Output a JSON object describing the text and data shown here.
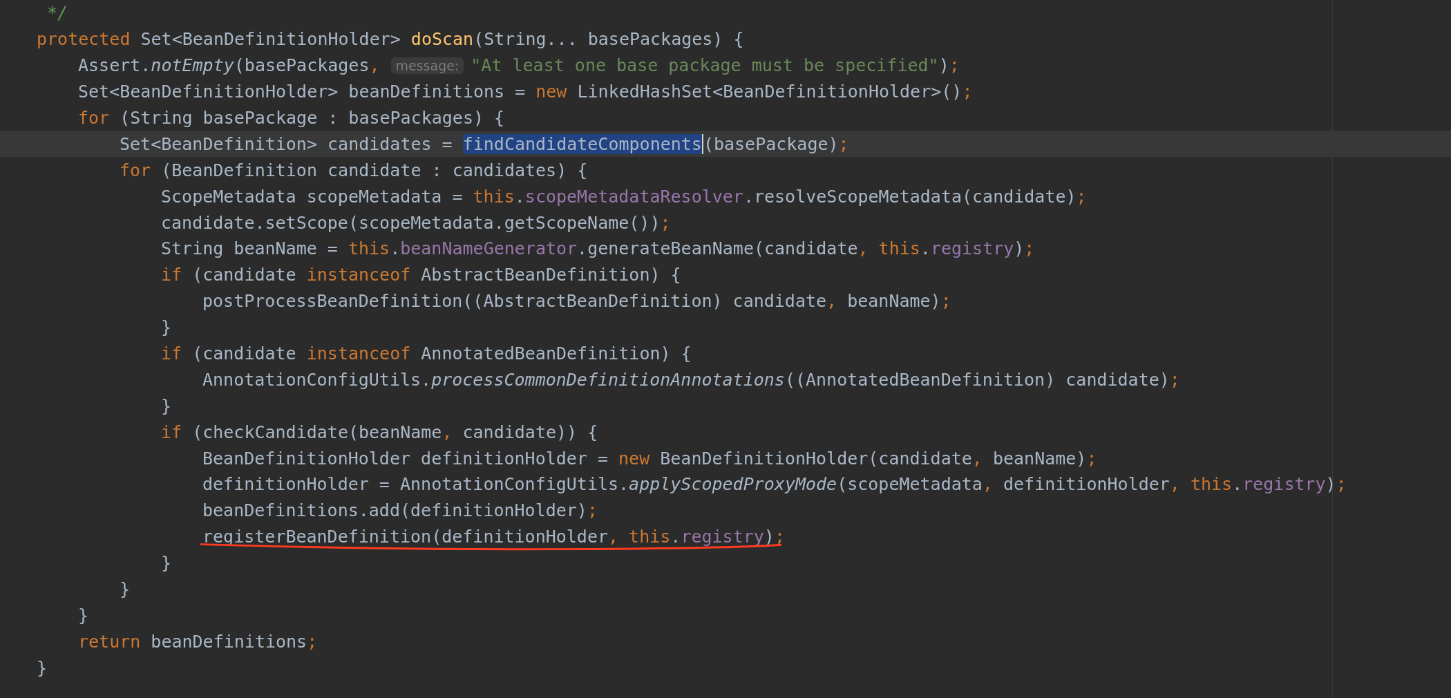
{
  "editor": {
    "lines": [
      {
        "current": false,
        "underlined": false,
        "tokens": [
          {
            "text": "*/",
            "kind": "comment"
          }
        ]
      },
      {
        "current": false,
        "underlined": false,
        "tokens": [
          {
            "text": "protected",
            "kind": "keyword"
          },
          {
            "text": " Set<BeanDefinitionHolder> ",
            "kind": "plain"
          },
          {
            "text": "doScan",
            "kind": "declaration"
          },
          {
            "text": "(String... basePackages) {",
            "kind": "plain"
          }
        ],
        "children": [
          {
            "current": false,
            "underlined": false,
            "tokens": [
              {
                "text": "Assert.",
                "kind": "plain"
              },
              {
                "text": "notEmpty",
                "kind": "static"
              },
              {
                "text": "(basePackages",
                "kind": "plain"
              },
              {
                "text": ",",
                "kind": "punct"
              },
              {
                "text": "message:",
                "kind": "hint"
              },
              {
                "text": "\"At least one base package must be specified\"",
                "kind": "string"
              },
              {
                "text": ")",
                "kind": "plain"
              },
              {
                "text": ";",
                "kind": "punct"
              }
            ]
          },
          {
            "current": false,
            "underlined": false,
            "tokens": [
              {
                "text": "Set<BeanDefinitionHolder> beanDefinitions = ",
                "kind": "plain"
              },
              {
                "text": "new",
                "kind": "keyword"
              },
              {
                "text": " LinkedHashSet<BeanDefinitionHolder>()",
                "kind": "plain"
              },
              {
                "text": ";",
                "kind": "punct"
              }
            ]
          },
          {
            "current": false,
            "underlined": false,
            "tokens": [
              {
                "text": "for",
                "kind": "keyword"
              },
              {
                "text": " (String basePackage : basePackages) {",
                "kind": "plain"
              }
            ],
            "children": [
              {
                "current": true,
                "underlined": false,
                "tokens": [
                  {
                    "text": "Set<BeanDefinition> candidates = ",
                    "kind": "plain"
                  },
                  {
                    "text": "findCandidateComponents",
                    "kind": "selection"
                  },
                  {
                    "text": "(basePackage)",
                    "kind": "plain"
                  },
                  {
                    "text": ";",
                    "kind": "punct"
                  }
                ]
              },
              {
                "current": false,
                "underlined": false,
                "tokens": [
                  {
                    "text": "for",
                    "kind": "keyword"
                  },
                  {
                    "text": " (BeanDefinition candidate : candidates) {",
                    "kind": "plain"
                  }
                ],
                "children": [
                  {
                    "current": false,
                    "underlined": false,
                    "tokens": [
                      {
                        "text": "ScopeMetadata scopeMetadata = ",
                        "kind": "plain"
                      },
                      {
                        "text": "this",
                        "kind": "keyword"
                      },
                      {
                        "text": ".",
                        "kind": "plain"
                      },
                      {
                        "text": "scopeMetadataResolver",
                        "kind": "field"
                      },
                      {
                        "text": ".resolveScopeMetadata(candidate)",
                        "kind": "plain"
                      },
                      {
                        "text": ";",
                        "kind": "punct"
                      }
                    ]
                  },
                  {
                    "current": false,
                    "underlined": false,
                    "tokens": [
                      {
                        "text": "candidate.setScope(scopeMetadata.getScopeName())",
                        "kind": "plain"
                      },
                      {
                        "text": ";",
                        "kind": "punct"
                      }
                    ]
                  },
                  {
                    "current": false,
                    "underlined": false,
                    "tokens": [
                      {
                        "text": "String beanName = ",
                        "kind": "plain"
                      },
                      {
                        "text": "this",
                        "kind": "keyword"
                      },
                      {
                        "text": ".",
                        "kind": "plain"
                      },
                      {
                        "text": "beanNameGenerator",
                        "kind": "field"
                      },
                      {
                        "text": ".generateBeanName(candidate",
                        "kind": "plain"
                      },
                      {
                        "text": ", ",
                        "kind": "punct"
                      },
                      {
                        "text": "this",
                        "kind": "keyword"
                      },
                      {
                        "text": ".",
                        "kind": "plain"
                      },
                      {
                        "text": "registry",
                        "kind": "field"
                      },
                      {
                        "text": ")",
                        "kind": "plain"
                      },
                      {
                        "text": ";",
                        "kind": "punct"
                      }
                    ]
                  },
                  {
                    "current": false,
                    "underlined": false,
                    "tokens": [
                      {
                        "text": "if",
                        "kind": "keyword"
                      },
                      {
                        "text": " (candidate ",
                        "kind": "plain"
                      },
                      {
                        "text": "instanceof",
                        "kind": "keyword"
                      },
                      {
                        "text": " AbstractBeanDefinition) {",
                        "kind": "plain"
                      }
                    ],
                    "children": [
                      {
                        "current": false,
                        "underlined": false,
                        "tokens": [
                          {
                            "text": "postProcessBeanDefinition((AbstractBeanDefinition) candidate",
                            "kind": "plain"
                          },
                          {
                            "text": ",",
                            "kind": "punct"
                          },
                          {
                            "text": " beanName)",
                            "kind": "plain"
                          },
                          {
                            "text": ";",
                            "kind": "punct"
                          }
                        ]
                      }
                    ]
                  },
                  {
                    "current": false,
                    "underlined": false,
                    "tokens": [
                      {
                        "text": "}",
                        "kind": "plain"
                      }
                    ]
                  },
                  {
                    "current": false,
                    "underlined": false,
                    "tokens": [
                      {
                        "text": "if",
                        "kind": "keyword"
                      },
                      {
                        "text": " (candidate ",
                        "kind": "plain"
                      },
                      {
                        "text": "instanceof",
                        "kind": "keyword"
                      },
                      {
                        "text": " AnnotatedBeanDefinition) {",
                        "kind": "plain"
                      }
                    ],
                    "children": [
                      {
                        "current": false,
                        "underlined": false,
                        "tokens": [
                          {
                            "text": "AnnotationConfigUtils.",
                            "kind": "plain"
                          },
                          {
                            "text": "processCommonDefinitionAnnotations",
                            "kind": "static"
                          },
                          {
                            "text": "((AnnotatedBeanDefinition) candidate)",
                            "kind": "plain"
                          },
                          {
                            "text": ";",
                            "kind": "punct"
                          }
                        ]
                      }
                    ]
                  },
                  {
                    "current": false,
                    "underlined": false,
                    "tokens": [
                      {
                        "text": "}",
                        "kind": "plain"
                      }
                    ]
                  },
                  {
                    "current": false,
                    "underlined": false,
                    "tokens": [
                      {
                        "text": "if",
                        "kind": "keyword"
                      },
                      {
                        "text": " (checkCandidate(beanName",
                        "kind": "plain"
                      },
                      {
                        "text": ",",
                        "kind": "punct"
                      },
                      {
                        "text": " candidate)) {",
                        "kind": "plain"
                      }
                    ],
                    "children": [
                      {
                        "current": false,
                        "underlined": false,
                        "tokens": [
                          {
                            "text": "BeanDefinitionHolder definitionHolder = ",
                            "kind": "plain"
                          },
                          {
                            "text": "new",
                            "kind": "keyword"
                          },
                          {
                            "text": " BeanDefinitionHolder(candidate",
                            "kind": "plain"
                          },
                          {
                            "text": ",",
                            "kind": "punct"
                          },
                          {
                            "text": " beanName)",
                            "kind": "plain"
                          },
                          {
                            "text": ";",
                            "kind": "punct"
                          }
                        ]
                      },
                      {
                        "current": false,
                        "underlined": false,
                        "tokens": [
                          {
                            "text": "definitionHolder = AnnotationConfigUtils.",
                            "kind": "plain"
                          },
                          {
                            "text": "applyScopedProxyMode",
                            "kind": "static"
                          },
                          {
                            "text": "(scopeMetadata",
                            "kind": "plain"
                          },
                          {
                            "text": ",",
                            "kind": "punct"
                          },
                          {
                            "text": " definitionHolder",
                            "kind": "plain"
                          },
                          {
                            "text": ", ",
                            "kind": "punct"
                          },
                          {
                            "text": "this",
                            "kind": "keyword"
                          },
                          {
                            "text": ".",
                            "kind": "plain"
                          },
                          {
                            "text": "registry",
                            "kind": "field"
                          },
                          {
                            "text": ")",
                            "kind": "plain"
                          },
                          {
                            "text": ";",
                            "kind": "punct"
                          }
                        ]
                      },
                      {
                        "current": false,
                        "underlined": false,
                        "tokens": [
                          {
                            "text": "beanDefinitions.add(definitionHolder)",
                            "kind": "plain"
                          },
                          {
                            "text": ";",
                            "kind": "punct"
                          }
                        ]
                      },
                      {
                        "current": false,
                        "underlined": true,
                        "tokens": [
                          {
                            "text": "registerBeanDefinition(definitionHolder",
                            "kind": "plain"
                          },
                          {
                            "text": ", ",
                            "kind": "punct"
                          },
                          {
                            "text": "this",
                            "kind": "keyword"
                          },
                          {
                            "text": ".",
                            "kind": "plain"
                          },
                          {
                            "text": "registry",
                            "kind": "field"
                          },
                          {
                            "text": ")",
                            "kind": "plain"
                          },
                          {
                            "text": ";",
                            "kind": "punct"
                          }
                        ]
                      }
                    ]
                  },
                  {
                    "current": false,
                    "underlined": false,
                    "tokens": [
                      {
                        "text": "}",
                        "kind": "plain"
                      }
                    ]
                  }
                ]
              },
              {
                "current": false,
                "underlined": false,
                "tokens": [
                  {
                    "text": "}",
                    "kind": "plain"
                  }
                ]
              }
            ]
          },
          {
            "current": false,
            "underlined": false,
            "tokens": [
              {
                "text": "}",
                "kind": "plain"
              }
            ]
          },
          {
            "current": false,
            "underlined": false,
            "tokens": [
              {
                "text": "return",
                "kind": "keyword"
              },
              {
                "text": " beanDefinitions",
                "kind": "plain"
              },
              {
                "text": ";",
                "kind": "punct"
              }
            ]
          }
        ]
      },
      {
        "current": false,
        "underlined": false,
        "tokens": [
          {
            "text": "}",
            "kind": "plain"
          }
        ]
      }
    ]
  }
}
